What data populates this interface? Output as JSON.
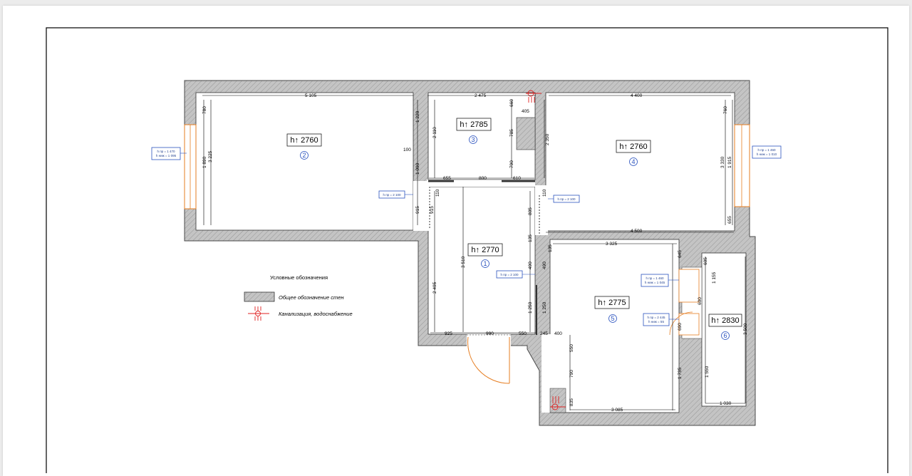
{
  "legend": {
    "title": "Условные обозначения",
    "walls": "Общее обозначение стен",
    "plumbing": "Канализация, водоснабжение"
  },
  "rooms": [
    {
      "id": "1",
      "label": "h↑ 2770",
      "number": "1"
    },
    {
      "id": "2",
      "label": "h↑ 2760",
      "number": "2"
    },
    {
      "id": "3",
      "label": "h↑ 2785",
      "number": "3"
    },
    {
      "id": "4",
      "label": "h↑ 2760",
      "number": "4"
    },
    {
      "id": "5",
      "label": "h↑ 2775",
      "number": "5"
    },
    {
      "id": "6",
      "label": "h↑ 2830",
      "number": "6"
    }
  ],
  "dimensions": {
    "d2_top": "5 105",
    "d2_left": "3 225",
    "d2_780": "780",
    "d2_1890": "1 890",
    "d3_top": "2 475",
    "d3_405": "405",
    "d3_660": "660",
    "d3_785": "785",
    "d3_790": "790",
    "d3_2110": "2 110",
    "d3_1220": "1 220",
    "d3_100": "100",
    "d_655": "655",
    "d_800": "800",
    "d_610": "610",
    "d_1090": "1 090",
    "d_915a": "915",
    "d_915b": "915",
    "d_110a": "110",
    "d_110b": "110",
    "d4_top": "4 400",
    "d4_760": "760",
    "d4_3330": "3 330",
    "d4_1915": "1 915",
    "d4_655": "655",
    "d4_bottom": "4 500",
    "d_2350": "2 350",
    "d_805": "805",
    "d1_3510": "3 510",
    "d1_2495": "2 495",
    "d1_925": "925",
    "d1_990": "990",
    "d1_550": "550",
    "d_135a": "135",
    "d_135b": "135",
    "d_490a": "490",
    "d_490b": "490",
    "d_1250a": "1 250",
    "d_1250b": "1 250",
    "d_245": "245",
    "d_400": "400",
    "d5_top": "3 325",
    "d5_645": "645",
    "d5_550": "550",
    "d5_790": "790",
    "d5_835": "835",
    "d5_1735": "1 735",
    "d5_bottom": "3 085",
    "d5_600": "600",
    "d5_690": "690",
    "d6_605": "605",
    "d6_1155": "1 155",
    "d6_3500": "3 500",
    "d6_1550": "1 550",
    "d6_1030": "1 030"
  },
  "notes": {
    "win_left": [
      "h пр = 1 470",
      "h ниж = 1 095"
    ],
    "win_right": [
      "h пр = 1 460",
      "h ниж = 1 010"
    ],
    "door_left": "h пр = 2 100",
    "door_right": "h пр = 2 100",
    "door_center": "h пр = 2 100",
    "balc_top": [
      "h пр = 1 460",
      "h ниж = 1 045"
    ],
    "balc_bottom": [
      "h пр = 2 445",
      "h ниж = 55"
    ]
  },
  "colors": {
    "wall_fill": "#bdbdbd",
    "wall_stroke": "#4a4a4a",
    "dimension": "#000000",
    "door_arc": "#e67e22",
    "window": "#e67e22",
    "note_border": "#2a52be",
    "plumbing": "#e02020",
    "room_number": "#2a52be"
  }
}
